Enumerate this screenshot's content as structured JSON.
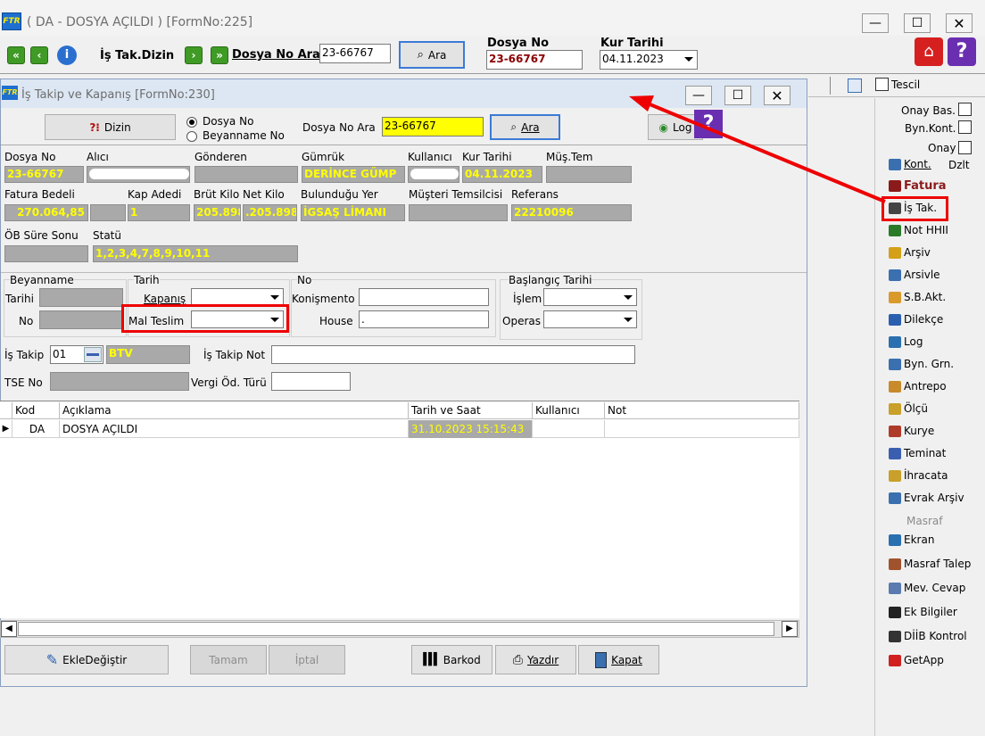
{
  "outer_window": {
    "title": "( DA  - DOSYA AÇILDI ) [FormNo:225]",
    "toolbar_label": "İş Tak.Dizin",
    "search_label": "Dosya No Ara",
    "search_value": "23-66767",
    "search_button": "Ara",
    "dosya_no_label": "Dosya No",
    "dosya_no_value": "23-66767",
    "kur_tarihi_label": "Kur Tarihi",
    "kur_tarihi_value": "04.11.2023",
    "tescil_label": "Tescil"
  },
  "side_panel": {
    "onay_bas": "Onay Bas.",
    "byn_kont": "Byn.Kont.",
    "onay": "Onay",
    "kont": "Kont.",
    "dzlt": "Dzlt",
    "items": [
      {
        "label": "Fatura",
        "color": "#8b1a1a"
      },
      {
        "label": "İş Tak.",
        "color": "#444444"
      },
      {
        "label": "Not HHII",
        "color": "#2a7a2a"
      },
      {
        "label": "Arşiv",
        "color": "#d4a017"
      },
      {
        "label": "Arsivle",
        "color": "#3a6fb0"
      },
      {
        "label": "S.B.Akt.",
        "color": "#d99a2b"
      },
      {
        "label": "Dilekçe",
        "color": "#2a5fb0"
      },
      {
        "label": "Log",
        "color": "#2a6fb0"
      },
      {
        "label": "Byn. Grn.",
        "color": "#3a6fb0"
      },
      {
        "label": "Antrepo",
        "color": "#c88a2a"
      },
      {
        "label": "Ölçü",
        "color": "#c8a02a"
      },
      {
        "label": "Kurye",
        "color": "#b03a2a"
      },
      {
        "label": "Teminat",
        "color": "#3a5fb0"
      },
      {
        "label": "İhracata",
        "color": "#c8a02a"
      },
      {
        "label": "Evrak Arşiv",
        "color": "#3a6fb0"
      }
    ],
    "masraf_header": "Masraf",
    "items2": [
      {
        "label": "Ekran",
        "color": "#2a6fb0"
      },
      {
        "label": "Masraf Talep",
        "color": "#a0522d"
      },
      {
        "label": "Mev. Cevap",
        "color": "#5a7ab0"
      },
      {
        "label": "Ek Bilgiler",
        "color": "#222222"
      },
      {
        "label": "DİİB Kontrol",
        "color": "#333333"
      },
      {
        "label": "GetApp",
        "color": "#d02020"
      }
    ]
  },
  "inner_window": {
    "title": "İş Takip ve Kapanış [FormNo:230]",
    "dizin_button": "Dizin",
    "radio_dosya": "Dosya No",
    "radio_beyanname": "Beyanname No",
    "search_label": "Dosya No Ara",
    "search_value": "23-66767",
    "search_button": "Ara",
    "log_button": "Log"
  },
  "fields": {
    "dosya_no_label": "Dosya No",
    "dosya_no": "23-66767",
    "alici_label": "Alıcı",
    "gonderen_label": "Gönderen",
    "gumruk_label": "Gümrük",
    "gumruk": "DERİNCE GÜMP",
    "kullanici_label": "Kullanıcı",
    "kur_tarihi_label": "Kur Tarihi",
    "kur_tarihi": "04.11.2023",
    "mus_tem_label": "Müş.Tem",
    "fatura_label": "Fatura Bedeli",
    "fatura": "270.064,85",
    "kap_label": "Kap Adedi",
    "kap": "1",
    "brut_label": "Brüt Kilo",
    "brut": "205.898",
    "net_label": "Net Kilo",
    "net": ".205.898",
    "yer_label": "Bulunduğu Yer",
    "yer": "İGSAŞ LİMANI",
    "temsilci_label": "Müşteri Temsilcisi",
    "referans_label": "Referans",
    "referans": "22210096",
    "ob_label": "ÖB Süre Sonu",
    "statu_label": "Statü",
    "statu": "1,2,3,4,7,8,9,10,11"
  },
  "sections": {
    "beyanname": "Beyanname",
    "tarihi": "Tarihi",
    "no": "No",
    "tarih": "Tarih",
    "kapanis": "Kapanış",
    "mal_teslim": "Mal Teslim",
    "no2": "No",
    "konismento": "Konişmento",
    "house": "House",
    "house_value": ".",
    "baslangic": "Başlangıç Tarihi",
    "islem": "İşlem",
    "operas": "Operas",
    "is_takip": "İş Takip",
    "is_takip_code": "01",
    "is_takip_value": "BTV",
    "is_takip_not": "İş Takip Not",
    "tse": "TSE No",
    "vergi": "Vergi Öd. Türü"
  },
  "grid": {
    "headers": [
      "Kod",
      "Açıklama",
      "Tarih ve Saat",
      "Kullanıcı",
      "Not"
    ],
    "rows": [
      {
        "kod": "DA",
        "aciklama": "DOSYA AÇILDI",
        "tarih": "31.10.2023 15:15:43",
        "kullanici": "",
        "not": ""
      }
    ]
  },
  "bottom_buttons": {
    "ekle": "EkleDeğiştir",
    "tamam": "Tamam",
    "iptal": "İptal",
    "barkod": "Barkod",
    "yazdir": "Yazdır",
    "kapat": "Kapat"
  }
}
